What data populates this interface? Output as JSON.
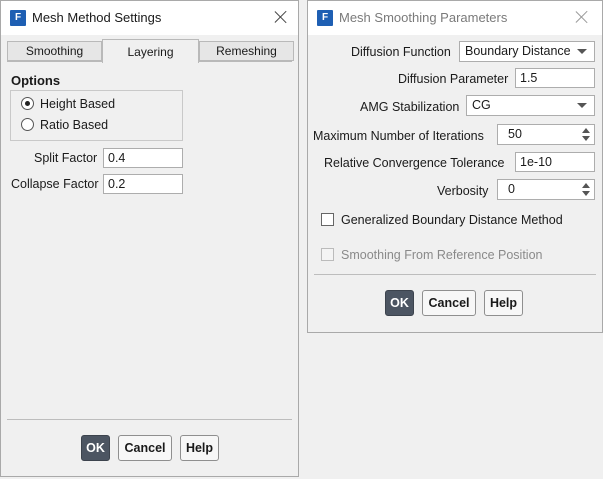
{
  "left_dialog": {
    "icon_letter": "F",
    "title": "Mesh Method Settings",
    "tabs": [
      {
        "label": "Smoothing",
        "active": false
      },
      {
        "label": "Layering",
        "active": true
      },
      {
        "label": "Remeshing",
        "active": false
      }
    ],
    "options_heading": "Options",
    "radios": [
      {
        "label": "Height Based",
        "selected": true
      },
      {
        "label": "Ratio Based",
        "selected": false
      }
    ],
    "split_factor": {
      "label": "Split Factor",
      "value": "0.4"
    },
    "collapse_factor": {
      "label": "Collapse Factor",
      "value": "0.2"
    },
    "buttons": {
      "ok": "OK",
      "cancel": "Cancel",
      "help": "Help"
    }
  },
  "right_dialog": {
    "icon_letter": "F",
    "title": "Mesh Smoothing Parameters",
    "diffusion_function": {
      "label": "Diffusion Function",
      "value": "Boundary Distance"
    },
    "diffusion_parameter": {
      "label": "Diffusion Parameter",
      "value": "1.5"
    },
    "amg_stabilization": {
      "label": "AMG Stabilization",
      "value": "CG"
    },
    "max_iterations": {
      "label": "Maximum Number of Iterations",
      "value": "50"
    },
    "relative_tolerance": {
      "label": "Relative Convergence Tolerance",
      "value": "1e-10"
    },
    "verbosity": {
      "label": "Verbosity",
      "value": "0"
    },
    "generalized_bd": {
      "label": "Generalized Boundary Distance Method",
      "checked": false
    },
    "smoothing_reference": {
      "label": "Smoothing From Reference Position",
      "checked": false,
      "disabled": true
    },
    "buttons": {
      "ok": "OK",
      "cancel": "Cancel",
      "help": "Help"
    }
  }
}
